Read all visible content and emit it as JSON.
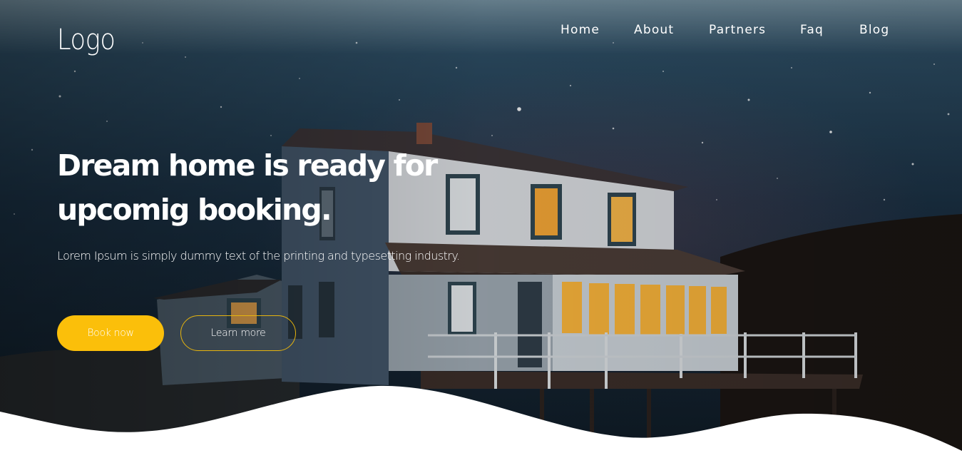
{
  "header": {
    "logo": "Logo",
    "nav": [
      {
        "label": "Home"
      },
      {
        "label": "About"
      },
      {
        "label": "Partners"
      },
      {
        "label": "Faq"
      },
      {
        "label": "Blog"
      }
    ]
  },
  "hero": {
    "headline_line1": "Dream home is ready for",
    "headline_line2": "upcomig booking.",
    "subtitle": "Lorem Ipsum is simply dummy text of the printing and typesetting industry.",
    "primary_button": "Book now",
    "secondary_button": "Learn more"
  },
  "colors": {
    "accent": "#fbbf0a",
    "sky": "#1c3347",
    "text": "#ffffff",
    "wave": "#ffffff"
  }
}
